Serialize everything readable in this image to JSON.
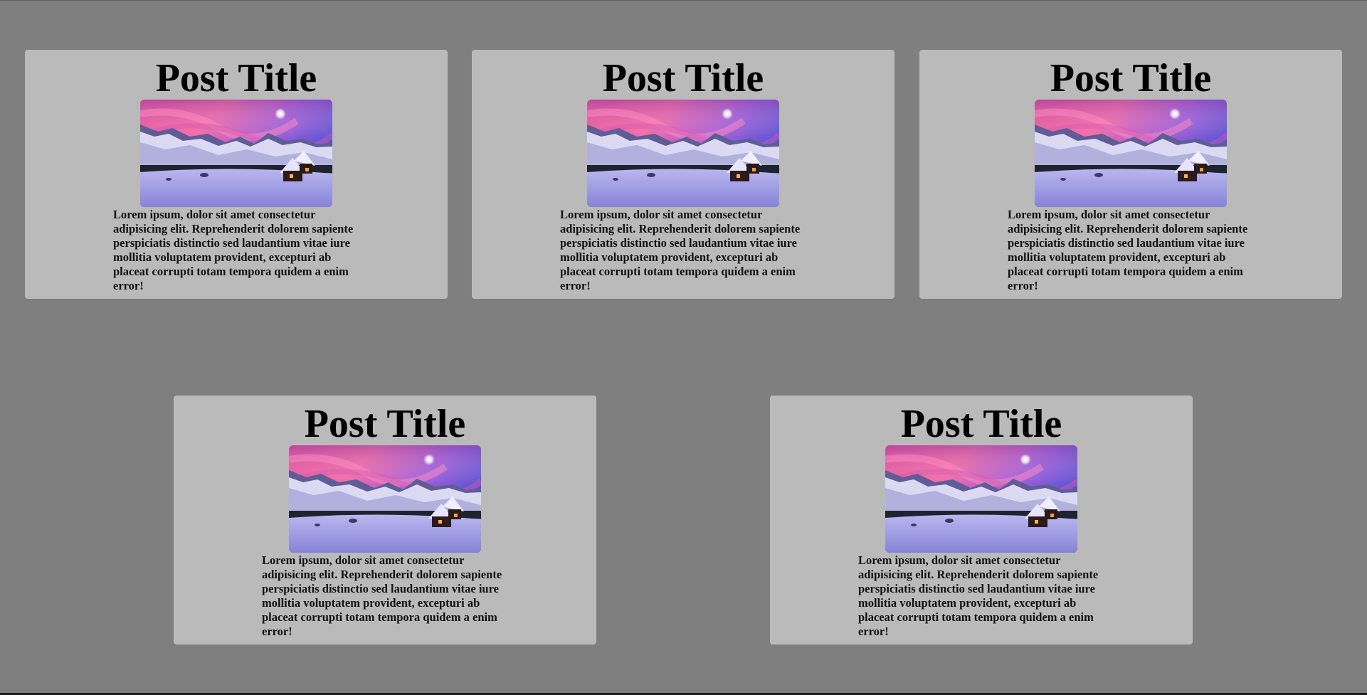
{
  "posts": [
    {
      "title": "Post Title",
      "image_alt": "snowy-mountain-cabin-at-pink-sunset",
      "body": "Lorem ipsum, dolor sit amet consectetur adipisicing elit. Reprehenderit dolorem sapiente perspiciatis distinctio sed laudantium vitae iure mollitia voluptatem provident, excepturi ab placeat corrupti totam tempora quidem a enim error!"
    },
    {
      "title": "Post Title",
      "image_alt": "snowy-mountain-cabin-at-pink-sunset",
      "body": "Lorem ipsum, dolor sit amet consectetur adipisicing elit. Reprehenderit dolorem sapiente perspiciatis distinctio sed laudantium vitae iure mollitia voluptatem provident, excepturi ab placeat corrupti totam tempora quidem a enim error!"
    },
    {
      "title": "Post Title",
      "image_alt": "snowy-mountain-cabin-at-pink-sunset",
      "body": "Lorem ipsum, dolor sit amet consectetur adipisicing elit. Reprehenderit dolorem sapiente perspiciatis distinctio sed laudantium vitae iure mollitia voluptatem provident, excepturi ab placeat corrupti totam tempora quidem a enim error!"
    },
    {
      "title": "Post Title",
      "image_alt": "snowy-mountain-cabin-at-pink-sunset",
      "body": "Lorem ipsum, dolor sit amet consectetur adipisicing elit. Reprehenderit dolorem sapiente perspiciatis distinctio sed laudantium vitae iure mollitia voluptatem provident, excepturi ab placeat corrupti totam tempora quidem a enim error!"
    },
    {
      "title": "Post Title",
      "image_alt": "snowy-mountain-cabin-at-pink-sunset",
      "body": "Lorem ipsum, dolor sit amet consectetur adipisicing elit. Reprehenderit dolorem sapiente perspiciatis distinctio sed laudantium vitae iure mollitia voluptatem provident, excepturi ab placeat corrupti totam tempora quidem a enim error!"
    }
  ],
  "colors": {
    "page_background": "#7f7f7f",
    "card_background": "#bababa",
    "text": "#000000"
  }
}
